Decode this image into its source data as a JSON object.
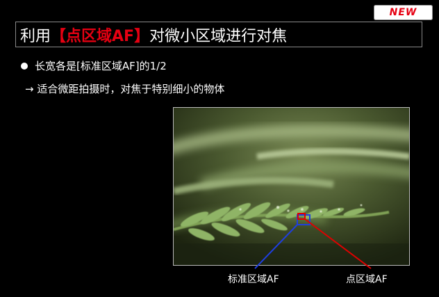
{
  "badge": {
    "text": "NEW"
  },
  "title": {
    "prefix": "利用",
    "bracket_open": "【",
    "highlight": "点区域AF",
    "bracket_close": "】",
    "suffix": "对微小区域进行对焦"
  },
  "bullet": {
    "text": "长宽各是[标准区域AF]的1/2"
  },
  "sub": {
    "text": "→ 适合微距拍摄时，对焦于特别细小的物体"
  },
  "labels": {
    "standard_af": "标准区域AF",
    "spot_af": "点区域AF"
  },
  "colors": {
    "accent_red": "#e60012",
    "af_blue": "#1f3fe0",
    "af_red": "#e00000"
  }
}
